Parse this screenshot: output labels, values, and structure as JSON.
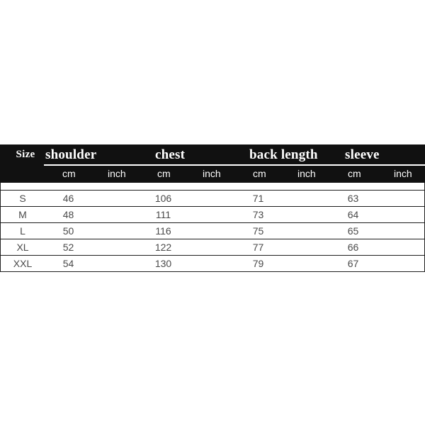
{
  "chart": {
    "size_column_header": "Size",
    "measurement_groups": [
      {
        "label": "shoulder",
        "key": "shoulder"
      },
      {
        "label": "chest",
        "key": "chest"
      },
      {
        "label": "back length",
        "key": "back_length"
      },
      {
        "label": "sleeve",
        "key": "sleeve"
      }
    ],
    "unit_headers": {
      "cm": "cm",
      "inch": "inch"
    },
    "rows": [
      {
        "size": "S",
        "shoulder_cm": "46",
        "shoulder_inch": "",
        "chest_cm": "106",
        "chest_inch": "",
        "back_length_cm": "71",
        "back_length_inch": "",
        "sleeve_cm": "63",
        "sleeve_inch": ""
      },
      {
        "size": "M",
        "shoulder_cm": "48",
        "shoulder_inch": "",
        "chest_cm": "111",
        "chest_inch": "",
        "back_length_cm": "73",
        "back_length_inch": "",
        "sleeve_cm": "64",
        "sleeve_inch": ""
      },
      {
        "size": "L",
        "shoulder_cm": "50",
        "shoulder_inch": "",
        "chest_cm": "116",
        "chest_inch": "",
        "back_length_cm": "75",
        "back_length_inch": "",
        "sleeve_cm": "65",
        "sleeve_inch": ""
      },
      {
        "size": "XL",
        "shoulder_cm": "52",
        "shoulder_inch": "",
        "chest_cm": "122",
        "chest_inch": "",
        "back_length_cm": "77",
        "back_length_inch": "",
        "sleeve_cm": "66",
        "sleeve_inch": ""
      },
      {
        "size": "XXL",
        "shoulder_cm": "54",
        "shoulder_inch": "",
        "chest_cm": "130",
        "chest_inch": "",
        "back_length_cm": "79",
        "back_length_inch": "",
        "sleeve_cm": "67",
        "sleeve_inch": ""
      }
    ]
  },
  "colors": {
    "header_background": "#111111",
    "header_text": "#ffffff",
    "page_background": "#ffffff",
    "cell_text": "#4a4a4a",
    "rule": "#1d1d1d"
  }
}
